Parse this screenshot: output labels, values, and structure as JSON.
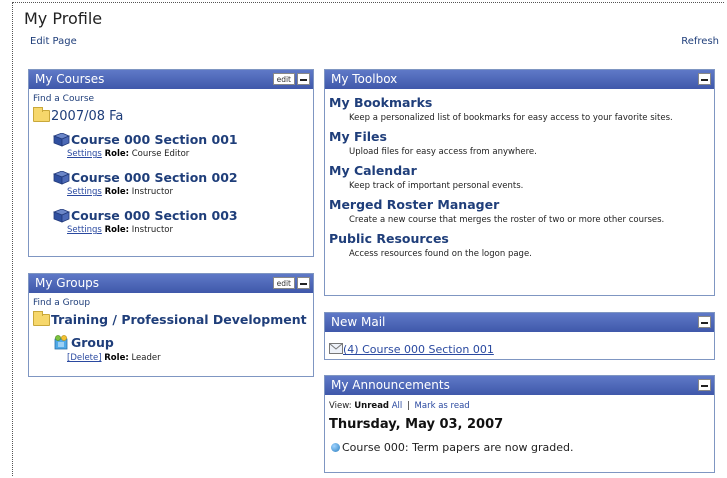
{
  "page": {
    "title": "My Profile",
    "edit_page": "Edit Page",
    "refresh": "Refresh"
  },
  "courses": {
    "title": "My Courses",
    "edit": "edit",
    "find": "Find a Course",
    "term": "2007/08 Fa",
    "items": [
      {
        "name": "Course 000 Section 001",
        "settings": "Settings",
        "role_label": "Role:",
        "role": "Course Editor"
      },
      {
        "name": "Course 000 Section 002",
        "settings": "Settings",
        "role_label": "Role:",
        "role": "Instructor"
      },
      {
        "name": "Course 000 Section 003",
        "settings": "Settings",
        "role_label": "Role:",
        "role": "Instructor"
      }
    ]
  },
  "groups": {
    "title": "My Groups",
    "edit": "edit",
    "find": "Find a Group",
    "folder": "Training / Professional Development",
    "item": {
      "name": "Group",
      "delete": "[Delete]",
      "role_label": "Role:",
      "role": "Leader"
    }
  },
  "toolbox": {
    "title": "My Toolbox",
    "items": [
      {
        "name": "My Bookmarks",
        "desc": "Keep a personalized list of bookmarks for easy access to your favorite sites."
      },
      {
        "name": "My Files",
        "desc": "Upload files for easy access from anywhere."
      },
      {
        "name": "My Calendar",
        "desc": "Keep track of important personal events."
      },
      {
        "name": "Merged Roster Manager",
        "desc": "Create a new course that merges the roster of two or more other courses."
      },
      {
        "name": "Public Resources",
        "desc": "Access resources found on the logon page."
      }
    ]
  },
  "mail": {
    "title": "New Mail",
    "link": "(4) Course 000 Section 001"
  },
  "announcements": {
    "title": "My Announcements",
    "view_label": "View:",
    "unread": "Unread",
    "all": "All",
    "sep": "|",
    "mark": "Mark as read",
    "date": "Thursday, May 03, 2007",
    "item": "Course 000: Term papers are now graded."
  },
  "colors": {
    "header": "#4a64b5",
    "link": "#1f3e7a"
  }
}
